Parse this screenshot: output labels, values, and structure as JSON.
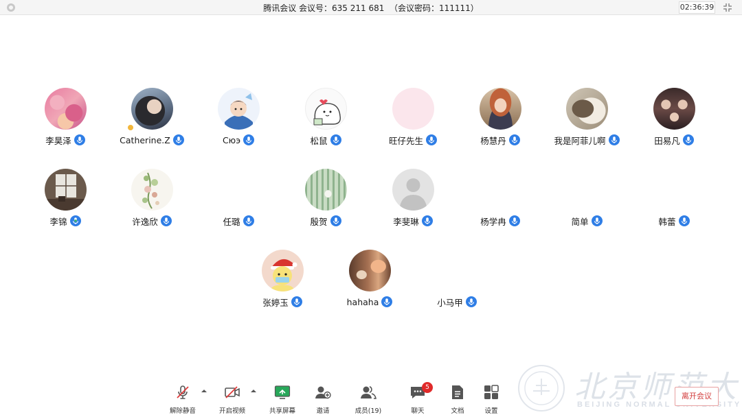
{
  "window": {
    "title": "腾讯会议 会议号：635 211 681  （会议密码：111111）",
    "clock": "02:36:39"
  },
  "participants": [
    {
      "name": "李昊泽",
      "avatar": "pink-abstract-photo",
      "mic_state": "active"
    },
    {
      "name": "Catherine.Z",
      "avatar": "woman-portrait-photo",
      "mic_state": "active",
      "host_badge": true
    },
    {
      "name": "Сюэ",
      "avatar": "cartoon-boy-illustration",
      "mic_state": "active"
    },
    {
      "name": "松鼠",
      "avatar": "cartoon-ghost-illustration",
      "mic_state": "active"
    },
    {
      "name": "旺仔先生",
      "avatar": "blank-pink-circle",
      "mic_state": "active"
    },
    {
      "name": "杨慧丹",
      "avatar": "red-haired-boy-photo",
      "mic_state": "active"
    },
    {
      "name": "我是阿菲儿啊",
      "avatar": "long-hair-figure-photo",
      "mic_state": "active"
    },
    {
      "name": "田易凡",
      "avatar": "group-photo",
      "mic_state": "active"
    },
    {
      "name": "李锦",
      "avatar": "window-room-photo",
      "mic_state": "speaking"
    },
    {
      "name": "许逸欣",
      "avatar": "flowers-drawing",
      "mic_state": "active"
    },
    {
      "name": "任璐",
      "avatar": "none",
      "mic_state": "active"
    },
    {
      "name": "殷贺",
      "avatar": "greenhouse-photo",
      "mic_state": "active"
    },
    {
      "name": "李斐琳",
      "avatar": "default-person",
      "mic_state": "active"
    },
    {
      "name": "杨学冉",
      "avatar": "none",
      "mic_state": "active"
    },
    {
      "name": "简单",
      "avatar": "none",
      "mic_state": "active"
    },
    {
      "name": "韩蕾",
      "avatar": "none",
      "mic_state": "active"
    },
    {
      "name": "张婷玉",
      "avatar": "santa-hat-cartoon",
      "mic_state": "active"
    },
    {
      "name": "hahaha",
      "avatar": "dim-room-photo",
      "mic_state": "active"
    },
    {
      "name": "小马甲",
      "avatar": "none",
      "mic_state": "active"
    }
  ],
  "toolbar": {
    "unmute": {
      "label": "解除静音",
      "icon": "mic-muted-icon"
    },
    "video": {
      "label": "开启视频",
      "icon": "camera-off-icon"
    },
    "share": {
      "label": "共享屏幕",
      "icon": "share-screen-icon"
    },
    "invite": {
      "label": "邀请",
      "icon": "add-user-icon"
    },
    "members": {
      "label": "成员(19)",
      "icon": "members-icon"
    },
    "chat": {
      "label": "聊天",
      "icon": "chat-icon",
      "badge": "5"
    },
    "docs": {
      "label": "文档",
      "icon": "document-icon"
    },
    "settings": {
      "label": "设置",
      "icon": "settings-grid-icon"
    },
    "leave": {
      "label": "离开会议"
    }
  },
  "watermark": {
    "cn": "北京师范大学",
    "en": "BEIJING NORMAL UNIVERSITY"
  },
  "colors": {
    "mic_blue": "#2f7ee6",
    "mic_speaking": "#33b36b",
    "leave_red": "#d23b3b",
    "badge_red": "#e02a2a"
  }
}
